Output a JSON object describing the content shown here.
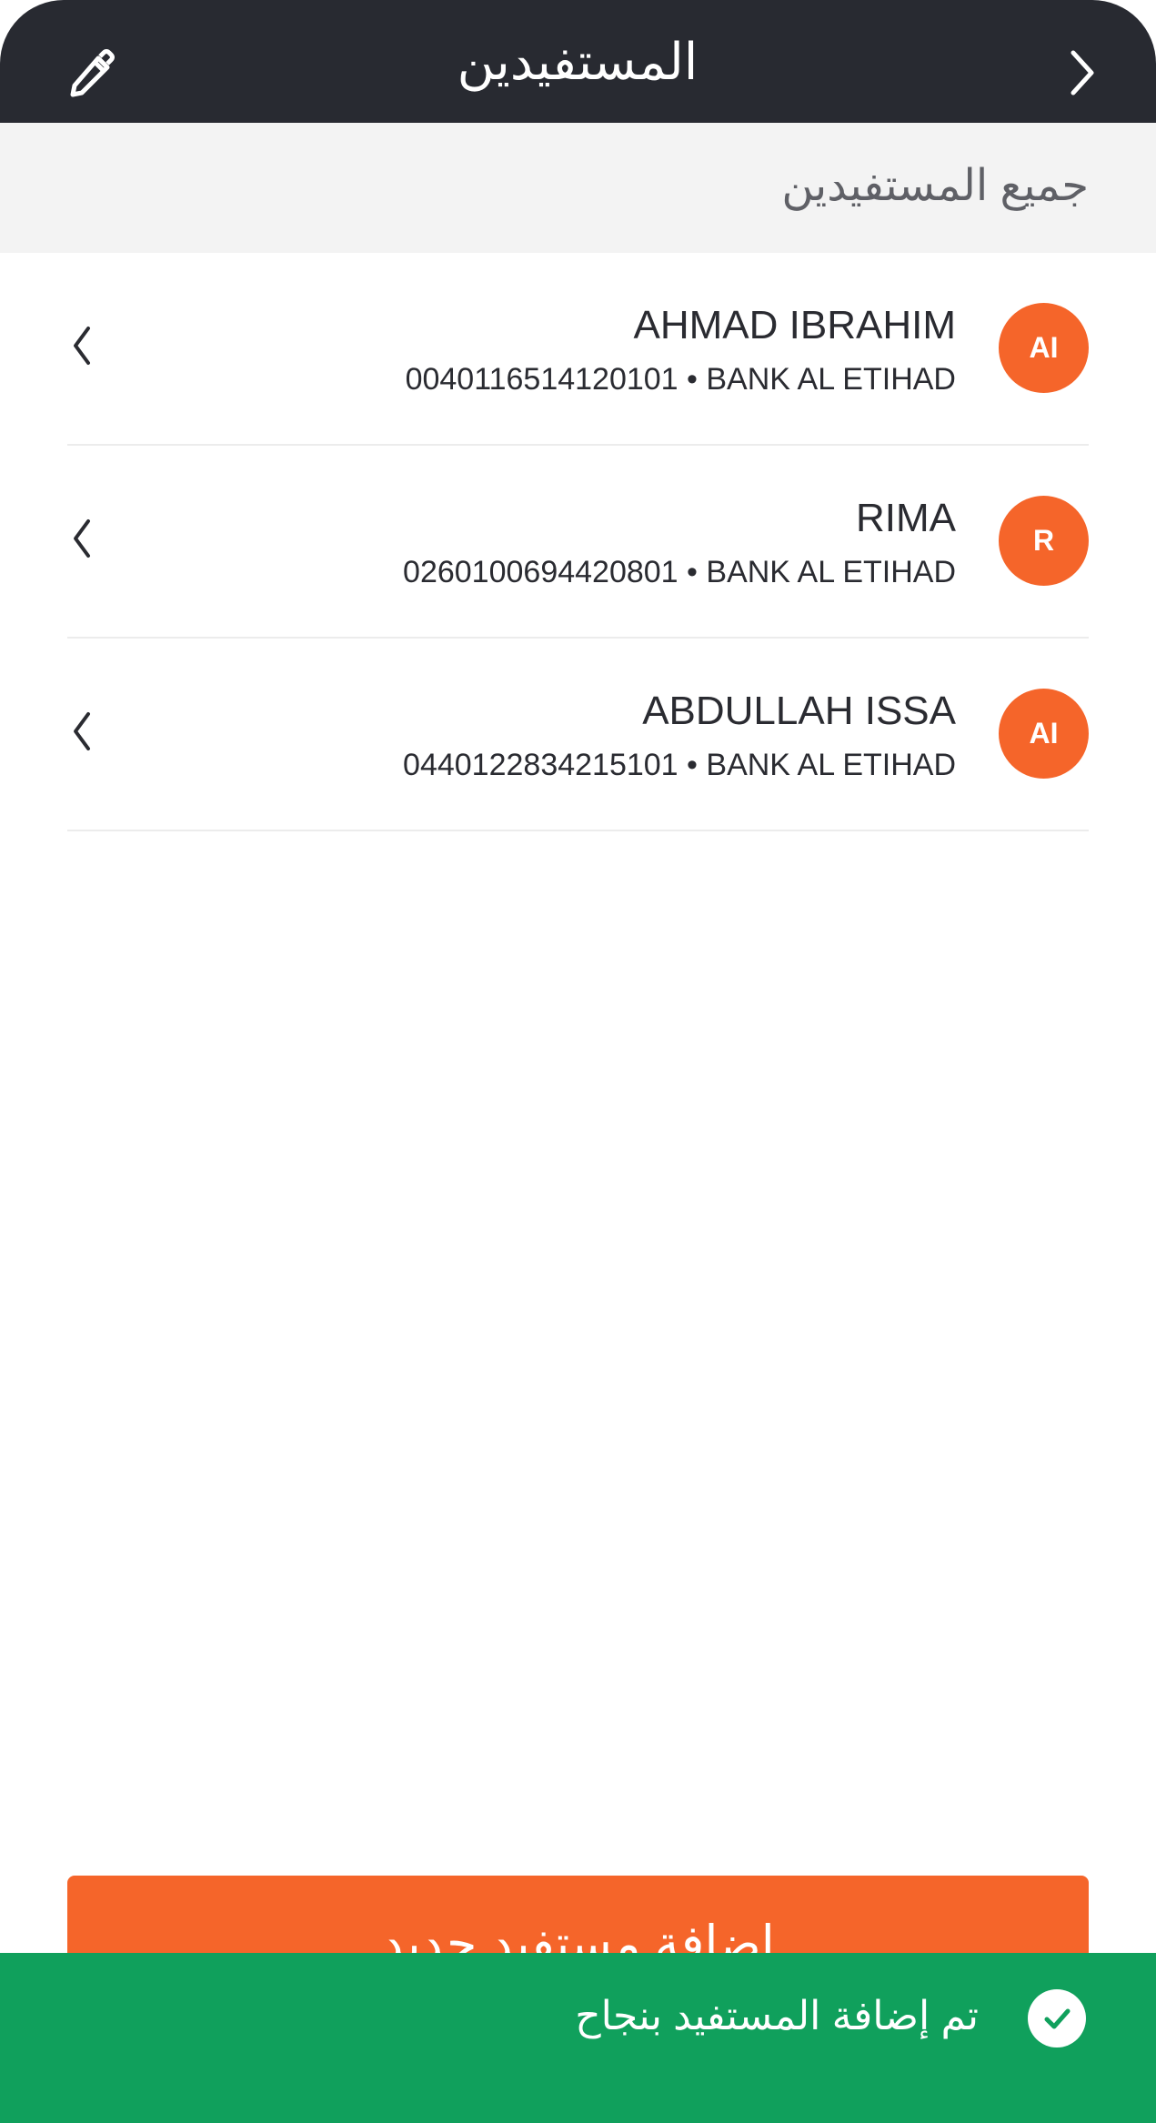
{
  "header": {
    "title": "المستفيدين",
    "edit_icon": "pencil-icon",
    "back_icon": "chevron-right-icon"
  },
  "section": {
    "title": "جميع المستفيدين"
  },
  "beneficiaries": [
    {
      "initials": "AI",
      "name": "AHMAD IBRAHIM",
      "details": "0040116514120101 • BANK AL ETIHAD"
    },
    {
      "initials": "R",
      "name": "RIMA",
      "details": "0260100694420801 • BANK AL ETIHAD"
    },
    {
      "initials": "AI",
      "name": "ABDULLAH ISSA",
      "details": "0440122834215101 • BANK AL ETIHAD"
    }
  ],
  "actions": {
    "add_beneficiary_label": "إضافة مستفيد جديد"
  },
  "toast": {
    "message": "تم إضافة المستفيد بنجاح",
    "icon": "check-icon"
  },
  "colors": {
    "topbar": "#282a31",
    "accent": "#f5652a",
    "success": "#10a05c",
    "section_bg": "#f3f3f3"
  }
}
